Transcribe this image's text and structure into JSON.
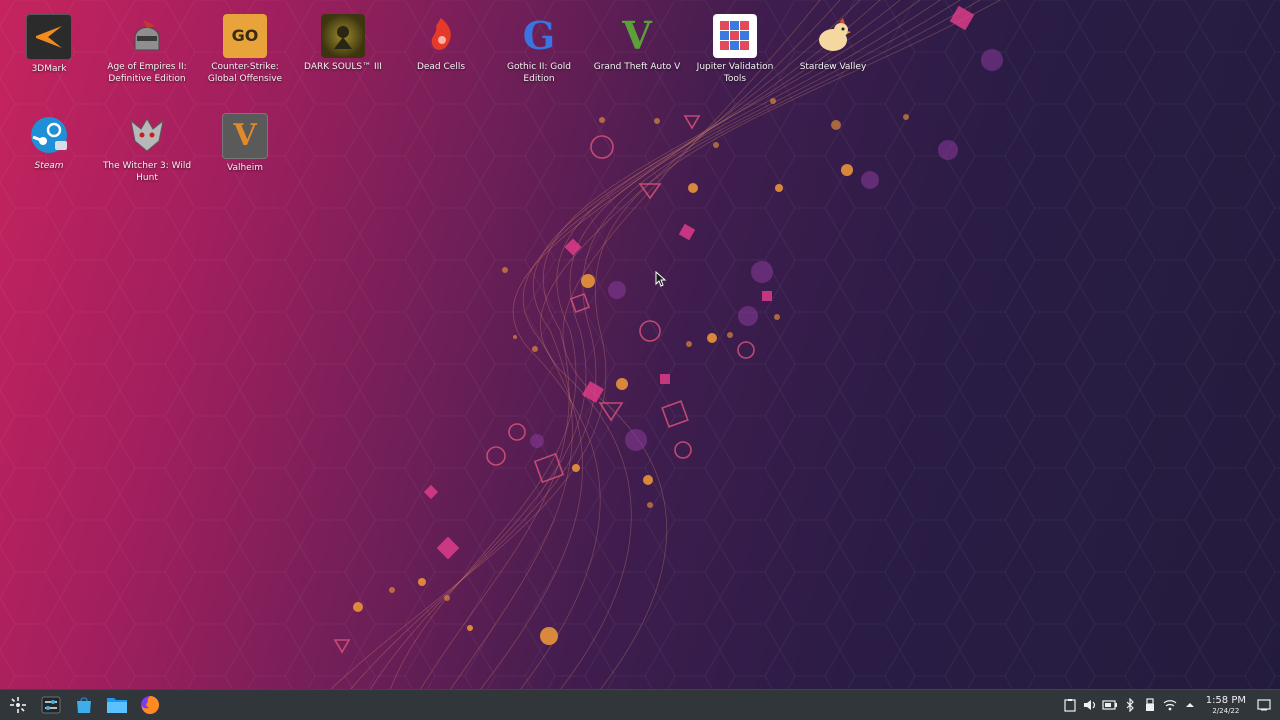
{
  "desktop": {
    "icons": [
      {
        "label": "3DMark",
        "icon": "3dmark-icon"
      },
      {
        "label": "Age of Empires II: Definitive Edition",
        "icon": "age-of-empires-icon"
      },
      {
        "label": "Counter-Strike: Global Offensive",
        "icon": "csgo-icon"
      },
      {
        "label": "DARK SOULS™ III",
        "icon": "dark-souls-icon"
      },
      {
        "label": "Dead Cells",
        "icon": "dead-cells-icon"
      },
      {
        "label": "Gothic II: Gold Edition",
        "icon": "gothic-icon"
      },
      {
        "label": "Grand Theft Auto V",
        "icon": "gta-v-icon"
      },
      {
        "label": "Jupiter Validation Tools",
        "icon": "jupiter-icon"
      },
      {
        "label": "Stardew Valley",
        "icon": "stardew-icon"
      },
      {
        "label": "Steam",
        "icon": "steam-icon"
      },
      {
        "label": "The Witcher 3: Wild Hunt",
        "icon": "witcher-icon"
      },
      {
        "label": "Valheim",
        "icon": "valheim-icon"
      }
    ],
    "icon_glyphs": {
      "csgo": "GO",
      "gothic": "G",
      "gta": "V",
      "valheim": "V"
    }
  },
  "taskbar": {
    "launchers": [
      "application-launcher-icon",
      "system-settings-icon",
      "discover-store-icon",
      "file-manager-icon",
      "firefox-icon"
    ],
    "tray": [
      "clipboard-icon",
      "volume-icon",
      "battery-icon",
      "bluetooth-icon",
      "usb-icon",
      "wifi-icon",
      "tray-expand-icon"
    ],
    "clock": {
      "time": "1:58 PM",
      "date": "2/24/22"
    },
    "show_desktop": "show-desktop-icon"
  },
  "colors": {
    "taskbar": "#31363b",
    "wallpaper_pink": "#c6245e",
    "wallpaper_purple": "#231b3d",
    "accent_orange": "#f5a03a"
  }
}
